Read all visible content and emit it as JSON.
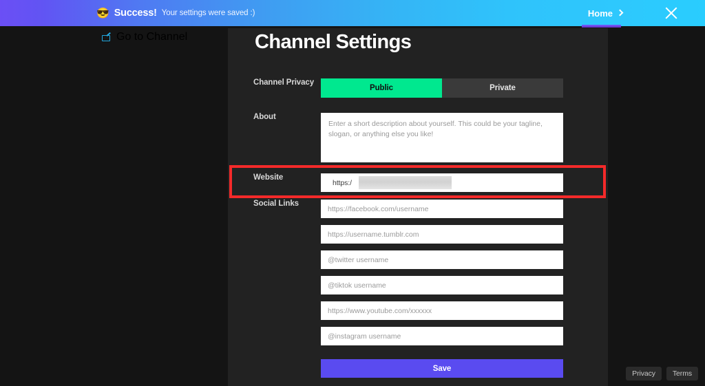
{
  "banner": {
    "emoji": "😎",
    "emoji_name": "sunglasses-face-emoji",
    "strong": "Success!",
    "message": "Your settings were saved :)",
    "home_label": "Home",
    "close_label": "×",
    "gradient_start": "#6b4ff5",
    "gradient_end": "#29cdfe"
  },
  "nav": {
    "go_to_channel": "Go to Channel",
    "accent_color": "#7b3ff2",
    "link_color": "#1f9fd8"
  },
  "page": {
    "title": "Channel Settings",
    "panel_bg": "#222222",
    "page_bg": "#141414"
  },
  "form": {
    "privacy": {
      "label": "Channel Privacy",
      "options": [
        "Public",
        "Private"
      ],
      "selected": "Public",
      "active_color": "#00e88f",
      "inactive_color": "#3a3a3a"
    },
    "about": {
      "label": "About",
      "placeholder": "Enter a short description about yourself. This could be your tagline, slogan, or anything else you like!",
      "value": ""
    },
    "website": {
      "label": "Website",
      "value": "https:/",
      "redacted": true
    },
    "social": {
      "label": "Social Links",
      "fields": [
        {
          "name": "facebook",
          "placeholder": "https://facebook.com/username",
          "value": ""
        },
        {
          "name": "tumblr",
          "placeholder": "https://username.tumblr.com",
          "value": ""
        },
        {
          "name": "twitter",
          "placeholder": "@twitter username",
          "value": ""
        },
        {
          "name": "tiktok",
          "placeholder": "@tiktok username",
          "value": ""
        },
        {
          "name": "youtube",
          "placeholder": "https://www.youtube.com/xxxxxx",
          "value": ""
        },
        {
          "name": "instagram",
          "placeholder": "@instagram username",
          "value": ""
        }
      ]
    },
    "save_label": "Save",
    "save_color": "#5a4bf0"
  },
  "highlight": {
    "color": "#f42a2a",
    "target": "website-field"
  },
  "footer": {
    "privacy": "Privacy",
    "terms": "Terms"
  }
}
